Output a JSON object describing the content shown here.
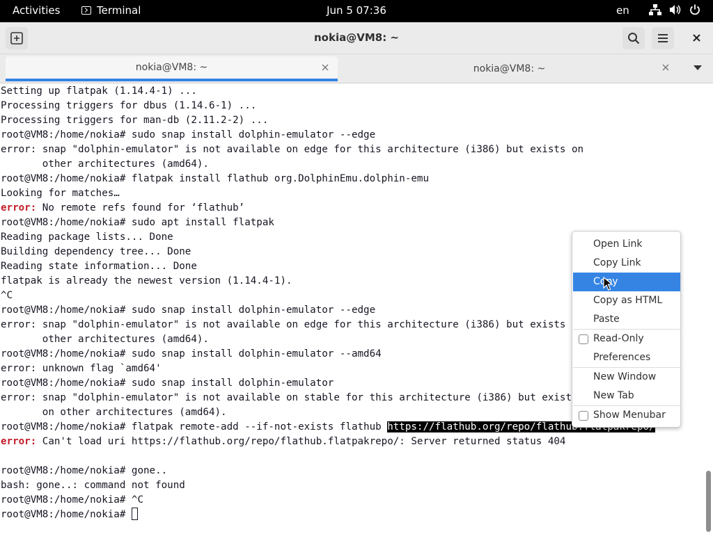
{
  "topbar": {
    "activities": "Activities",
    "app_name": "Terminal",
    "clock": "Jun 5  07:36",
    "language": "en"
  },
  "window": {
    "title": "nokia@VM8: ~"
  },
  "tabs": [
    {
      "label": "nokia@VM8: ~",
      "active": true
    },
    {
      "label": "nokia@VM8: ~",
      "active": false
    }
  ],
  "terminal": {
    "lines": [
      "Setting up flatpak (1.14.4-1) ...",
      "Processing triggers for dbus (1.14.6-1) ...",
      "Processing triggers for man-db (2.11.2-2) ...",
      "root@VM8:/home/nokia# sudo snap install dolphin-emulator --edge",
      "error: snap \"dolphin-emulator\" is not available on edge for this architecture (i386) but exists on",
      "       other architectures (amd64).",
      "root@VM8:/home/nokia# flatpak install flathub org.DolphinEmu.dolphin-emu",
      "Looking for matches…",
      {
        "err": "error:",
        "rest": " No remote refs found for ‘flathub’"
      },
      "root@VM8:/home/nokia# sudo apt install flatpak",
      "Reading package lists... Done",
      "Building dependency tree... Done",
      "Reading state information... Done",
      "flatpak is already the newest version (1.14.4-1).",
      "^C",
      "root@VM8:/home/nokia# sudo snap install dolphin-emulator --edge",
      "error: snap \"dolphin-emulator\" is not available on edge for this architecture (i386) but exists on",
      "       other architectures (amd64).",
      "root@VM8:/home/nokia# sudo snap install dolphin-emulator --amd64",
      "error: unknown flag `amd64'",
      "root@VM8:/home/nokia# sudo snap install dolphin-emulator",
      "error: snap \"dolphin-emulator\" is not available on stable for this architecture (i386) but exists",
      "       on other architectures (amd64).",
      {
        "pre": "root@VM8:/home/nokia# flatpak remote-add --if-not-exists flathub ",
        "sel": "https://flathub.org/repo/flathub.flatpakrepo/"
      },
      {
        "err": "error:",
        "rest": " Can't load uri https://flathub.org/repo/flathub.flatpakrepo/: Server returned status 404"
      },
      "",
      "root@VM8:/home/nokia# gone..",
      "bash: gone..: command not found",
      "root@VM8:/home/nokia# ^C",
      {
        "prompt": "root@VM8:/home/nokia# ",
        "cursor": true
      }
    ]
  },
  "context_menu": {
    "open_link": "Open Link",
    "copy_link": "Copy Link",
    "copy": "Copy",
    "copy_as_html": "Copy as HTML",
    "paste": "Paste",
    "read_only": "Read-Only",
    "preferences": "Preferences",
    "new_window": "New Window",
    "new_tab": "New Tab",
    "show_menubar": "Show Menubar"
  },
  "colors": {
    "accent": "#3584e4",
    "error": "#c01c28",
    "topbar": "#000000"
  }
}
